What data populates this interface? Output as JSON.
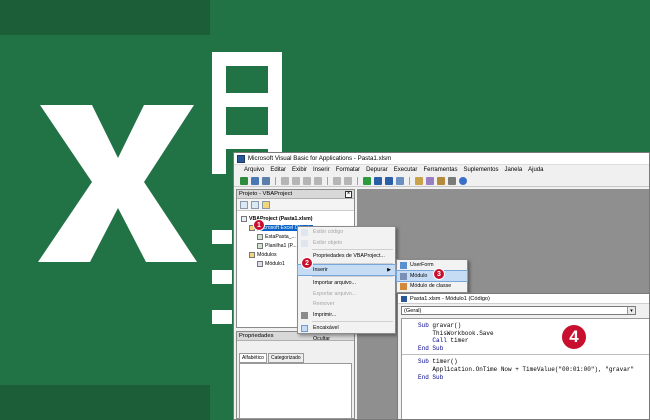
{
  "window": {
    "title": "Microsoft Visual Basic for Applications - Pasta1.xlsm"
  },
  "menubar": [
    "Arquivo",
    "Editar",
    "Exibir",
    "Inserir",
    "Formatar",
    "Depurar",
    "Executar",
    "Ferramentas",
    "Suplementos",
    "Janela",
    "Ajuda"
  ],
  "project_panel": {
    "title": "Projeto - VBAProject",
    "close_label": "×",
    "tree": [
      {
        "label": "VBAProject (Pasta1.xlsm)",
        "selected": false
      },
      {
        "label": "Microsoft Excel Objects",
        "selected": true
      },
      {
        "label": "EstaPasta_...",
        "selected": false
      },
      {
        "label": "Planilha1 (P...",
        "selected": false
      },
      {
        "label": "Módulos",
        "selected": false
      },
      {
        "label": "Módulo1",
        "selected": false
      }
    ]
  },
  "properties_panel": {
    "title": "Propriedades",
    "tabs": [
      "Alfabético",
      "Categorizado"
    ]
  },
  "context_menu": {
    "items": [
      {
        "label": "Exibir código",
        "disabled": true
      },
      {
        "label": "Exibir objeto",
        "disabled": true
      },
      {
        "label": "Propriedades de VBAProject...",
        "disabled": false
      },
      {
        "label": "Inserir",
        "disabled": false
      },
      {
        "label": "Importar arquivo...",
        "disabled": false
      },
      {
        "label": "Exportar arquivo...",
        "disabled": true
      },
      {
        "label": "Remover",
        "disabled": true
      },
      {
        "label": "Imprimir...",
        "disabled": false
      },
      {
        "label": "Encaixável",
        "disabled": false
      },
      {
        "label": "Ocultar",
        "disabled": false
      }
    ],
    "submenu_arrow": "▶"
  },
  "submenu": {
    "items": [
      "UserForm",
      "Módulo",
      "Módulo de classe"
    ]
  },
  "code_window": {
    "title": "Pasta1.xlsm - Módulo1 (Código)",
    "combo_value": "(Geral)",
    "combo_arrow": "▾",
    "lines_block1": [
      "Sub gravar()",
      "    ThisWorkbook.Save",
      "    Call timer",
      "End Sub"
    ],
    "lines_block2": [
      "Sub timer()",
      "    Application.OnTime Now + TimeValue(\"00:01:00\"), \"gravar\"",
      "End Sub"
    ]
  },
  "badges": {
    "b1": "1",
    "b2": "2",
    "b3": "3",
    "b4": "4"
  },
  "colors": {
    "excel_green": "#217346",
    "badge_red": "#c8102e",
    "selection_blue": "#0a64c8"
  }
}
